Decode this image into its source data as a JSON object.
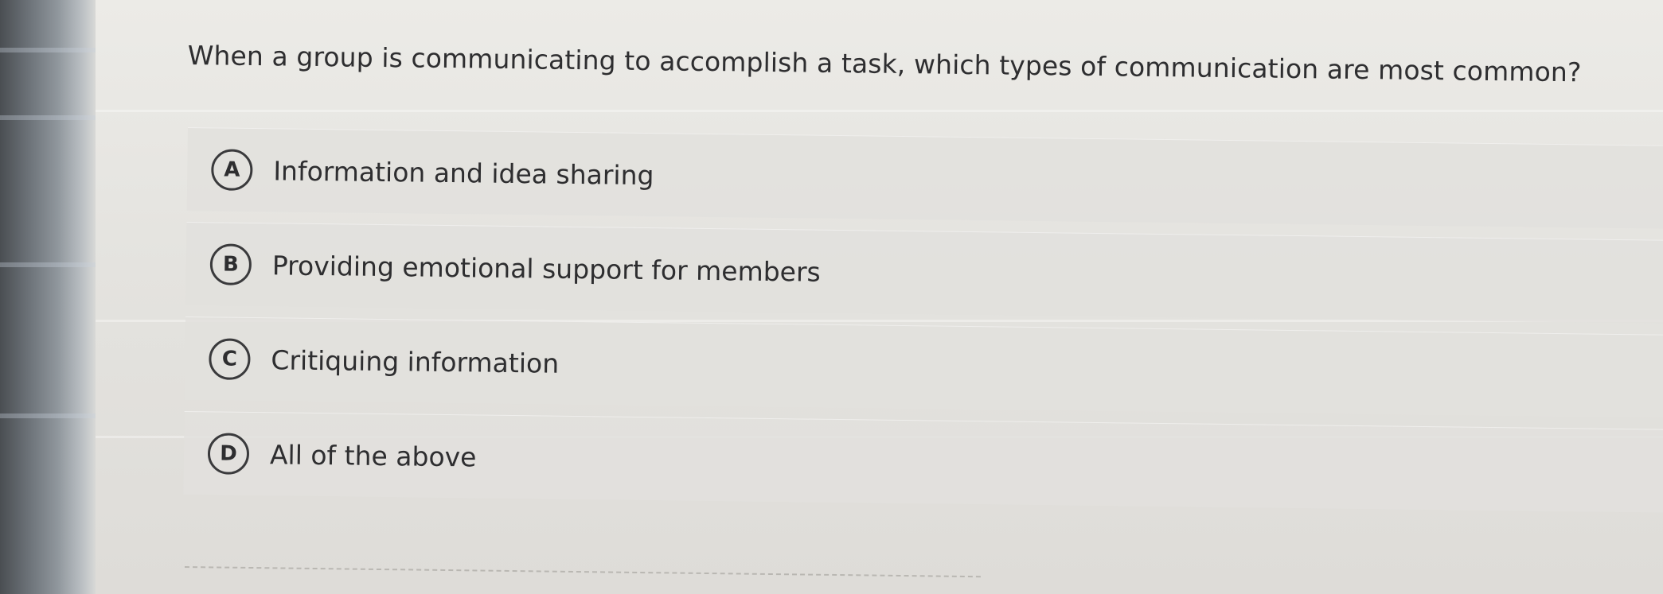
{
  "question": {
    "text": "When a group is communicating to accomplish a task, which types of communication are most common?"
  },
  "options": [
    {
      "letter": "A",
      "label": "Information and idea sharing"
    },
    {
      "letter": "B",
      "label": "Providing emotional support for members"
    },
    {
      "letter": "C",
      "label": "Critiquing information"
    },
    {
      "letter": "D",
      "label": "All of the above"
    }
  ],
  "colors": {
    "text": "#2e2e30",
    "background": "#e6e5e1",
    "option_background": "#e2e1dd",
    "bezel": "#6c7278"
  }
}
